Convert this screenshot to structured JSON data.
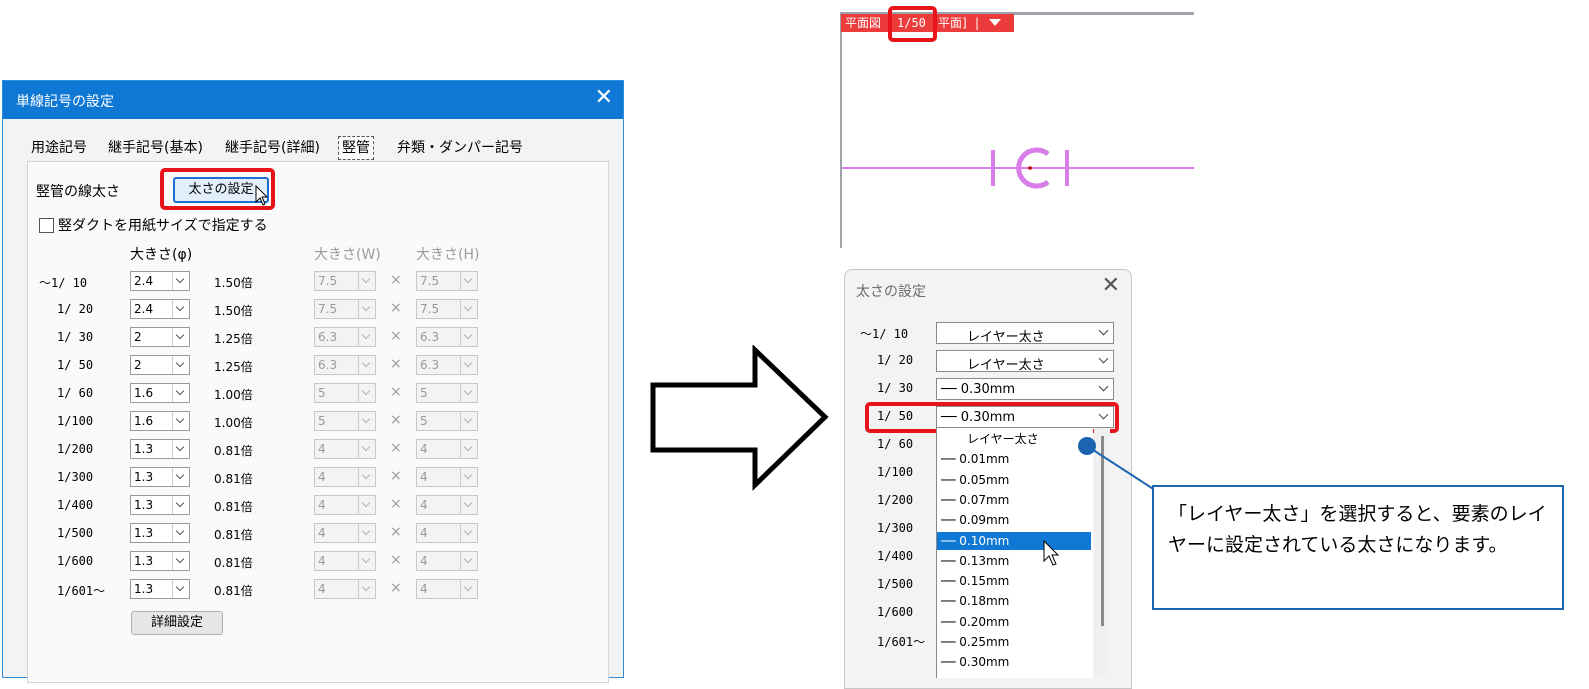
{
  "left_dialog": {
    "title": "単線記号の設定",
    "close": "✕",
    "tabs": [
      "用途記号",
      "継手記号(基本)",
      "継手記号(詳細)",
      "竪管",
      "弁類・ダンパー記号"
    ],
    "line_width_label": "竪管の線太さ",
    "width_button": "太さの設定",
    "duct_checkbox_label": "竪ダクトを用紙サイズで指定する",
    "col_phi": "大きさ(φ)",
    "col_w": "大きさ(W)",
    "col_h": "大きさ(H)",
    "times": "×",
    "rows": [
      {
        "scale": "～1/ 10",
        "phi": "2.4",
        "mult": "1.50倍",
        "w": "7.5",
        "h": "7.5"
      },
      {
        "scale": "1/ 20",
        "phi": "2.4",
        "mult": "1.50倍",
        "w": "7.5",
        "h": "7.5"
      },
      {
        "scale": "1/ 30",
        "phi": "2",
        "mult": "1.25倍",
        "w": "6.3",
        "h": "6.3"
      },
      {
        "scale": "1/ 50",
        "phi": "2",
        "mult": "1.25倍",
        "w": "6.3",
        "h": "6.3"
      },
      {
        "scale": "1/ 60",
        "phi": "1.6",
        "mult": "1.00倍",
        "w": "5",
        "h": "5"
      },
      {
        "scale": "1/100",
        "phi": "1.6",
        "mult": "1.00倍",
        "w": "5",
        "h": "5"
      },
      {
        "scale": "1/200",
        "phi": "1.3",
        "mult": "0.81倍",
        "w": "4",
        "h": "4"
      },
      {
        "scale": "1/300",
        "phi": "1.3",
        "mult": "0.81倍",
        "w": "4",
        "h": "4"
      },
      {
        "scale": "1/400",
        "phi": "1.3",
        "mult": "0.81倍",
        "w": "4",
        "h": "4"
      },
      {
        "scale": "1/500",
        "phi": "1.3",
        "mult": "0.81倍",
        "w": "4",
        "h": "4"
      },
      {
        "scale": "1/600",
        "phi": "1.3",
        "mult": "0.81倍",
        "w": "4",
        "h": "4"
      },
      {
        "scale": "1/601～",
        "phi": "1.3",
        "mult": "0.81倍",
        "w": "4",
        "h": "4"
      }
    ],
    "detail_button": "詳細設定"
  },
  "view": {
    "tag1": "平面図",
    "scale": "1/50",
    "tag2": "平面]",
    "sep": "|",
    "menu_icon": "caret-down-icon"
  },
  "right_dialog": {
    "title": "太さの設定",
    "close": "✕",
    "rows": [
      {
        "scale": "～1/ 10",
        "value": "レイヤー太さ"
      },
      {
        "scale": "1/ 20",
        "value": "レイヤー太さ"
      },
      {
        "scale": "1/ 30",
        "value": "── 0.30mm"
      },
      {
        "scale": "1/ 50",
        "value": "── 0.30mm"
      },
      {
        "scale": "1/ 60"
      },
      {
        "scale": "1/100"
      },
      {
        "scale": "1/200"
      },
      {
        "scale": "1/300"
      },
      {
        "scale": "1/400"
      },
      {
        "scale": "1/500"
      },
      {
        "scale": "1/600"
      },
      {
        "scale": "1/601～"
      }
    ],
    "dropdown_items": [
      "レイヤー太さ",
      "── 0.01mm",
      "── 0.05mm",
      "── 0.07mm",
      "── 0.09mm",
      "── 0.10mm",
      "── 0.13mm",
      "── 0.15mm",
      "── 0.18mm",
      "── 0.20mm",
      "── 0.25mm",
      "── 0.30mm"
    ],
    "selected_item": "── 0.10mm"
  },
  "callout": {
    "text": "「レイヤー太さ」を選択すると、要素のレイヤーに設定されている太さになります。"
  },
  "colors": {
    "title_blue": "#0f78d4",
    "highlight_red": "#e8121a",
    "view_bar": "#ec3b3b",
    "symbol_pink": "#d97ee8",
    "callout_border": "#1c64b0"
  }
}
